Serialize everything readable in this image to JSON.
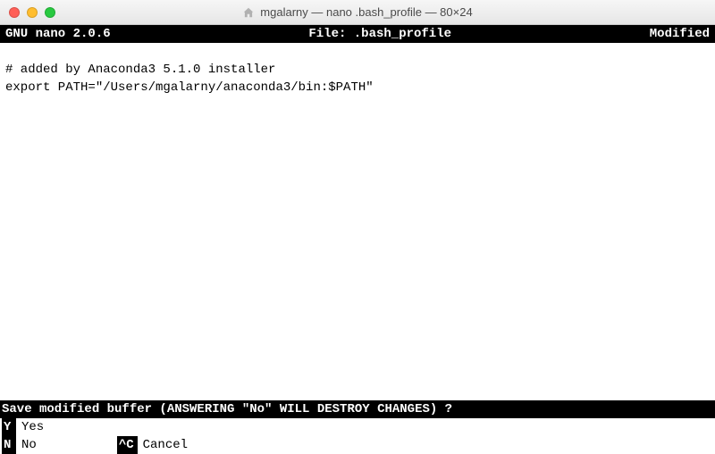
{
  "window": {
    "title": "mgalarny — nano .bash_profile — 80×24"
  },
  "nano": {
    "header": {
      "app": "GNU nano 2.0.6",
      "file_label": "File: .bash_profile",
      "status": "Modified"
    },
    "content": {
      "line1": "# added by Anaconda3 5.1.0 installer",
      "line2": "export PATH=\"/Users/mgalarny/anaconda3/bin:$PATH\""
    },
    "prompt": "Save modified buffer (ANSWERING \"No\" WILL DESTROY CHANGES) ? ",
    "options": {
      "yes": {
        "key": "Y",
        "label": "Yes"
      },
      "no": {
        "key": "N",
        "label": "No"
      },
      "cancel": {
        "key": "^C",
        "label": "Cancel"
      }
    }
  }
}
